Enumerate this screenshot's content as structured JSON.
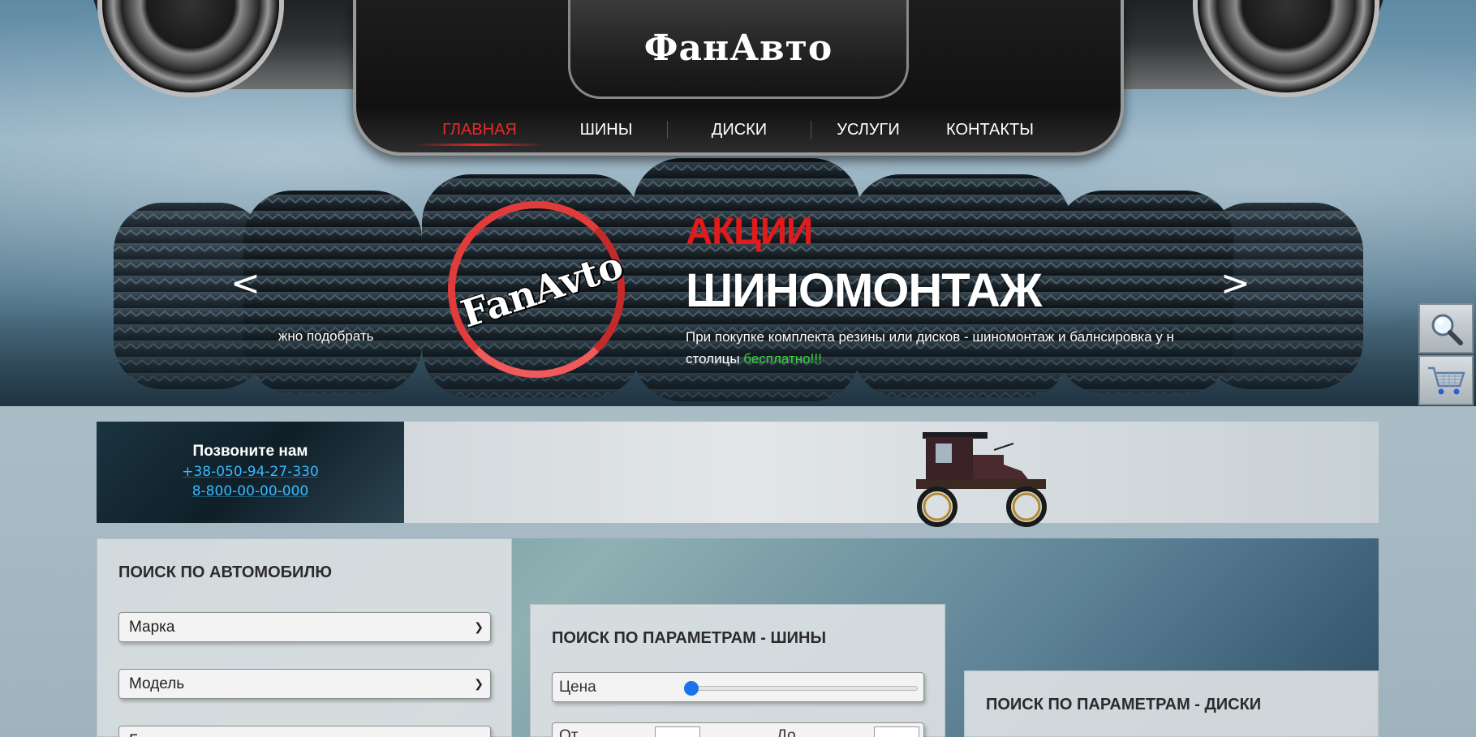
{
  "header": {
    "logo": "ФанАвто",
    "nav": [
      {
        "label": "ГЛАВНАЯ",
        "active": true
      },
      {
        "label": "ШИНЫ",
        "active": false
      },
      {
        "label": "ДИСКИ",
        "active": false
      },
      {
        "label": "УСЛУГИ",
        "active": false
      },
      {
        "label": "КОНТАКТЫ",
        "active": false
      }
    ]
  },
  "slider": {
    "prev_arrow": "<",
    "next_arrow": ">",
    "prev_slide_text": "жно подобрать",
    "logo_text": "FanAvto",
    "title": "АКЦИИ",
    "heading": "ШИНОМОНТАЖ",
    "text_line1": "При покупке комплекта резины или дисков - шиномонтаж и балнсировка у н",
    "text_line2_prefix": "столицы ",
    "text_line2_highlight": "бесплатно!!!"
  },
  "side_buttons": [
    {
      "icon": "search-icon"
    },
    {
      "icon": "cart-icon"
    }
  ],
  "contact": {
    "title": "Позвоните нам",
    "phone1": "+38-050-94-27-330",
    "phone2": "8-800-00-00-000"
  },
  "search_by_car": {
    "title": "ПОИСК ПО АВТОМОБИЛЮ",
    "make_select": "Марка",
    "model_select": "Модель",
    "year_select": "Г"
  },
  "search_tires": {
    "title": "ПОИСК ПО ПАРАМЕТРАМ - ШИНЫ",
    "price_label": "Цена",
    "price_slider_value": 0,
    "from_label": "От",
    "to_label": "До"
  },
  "search_disks": {
    "title": "ПОИСК ПО ПАРАМЕТРАМ - ДИСКИ"
  },
  "colors": {
    "accent_red": "#e52a2a",
    "promo_green": "#3bd33b",
    "phone_blue": "#38b9ff"
  }
}
